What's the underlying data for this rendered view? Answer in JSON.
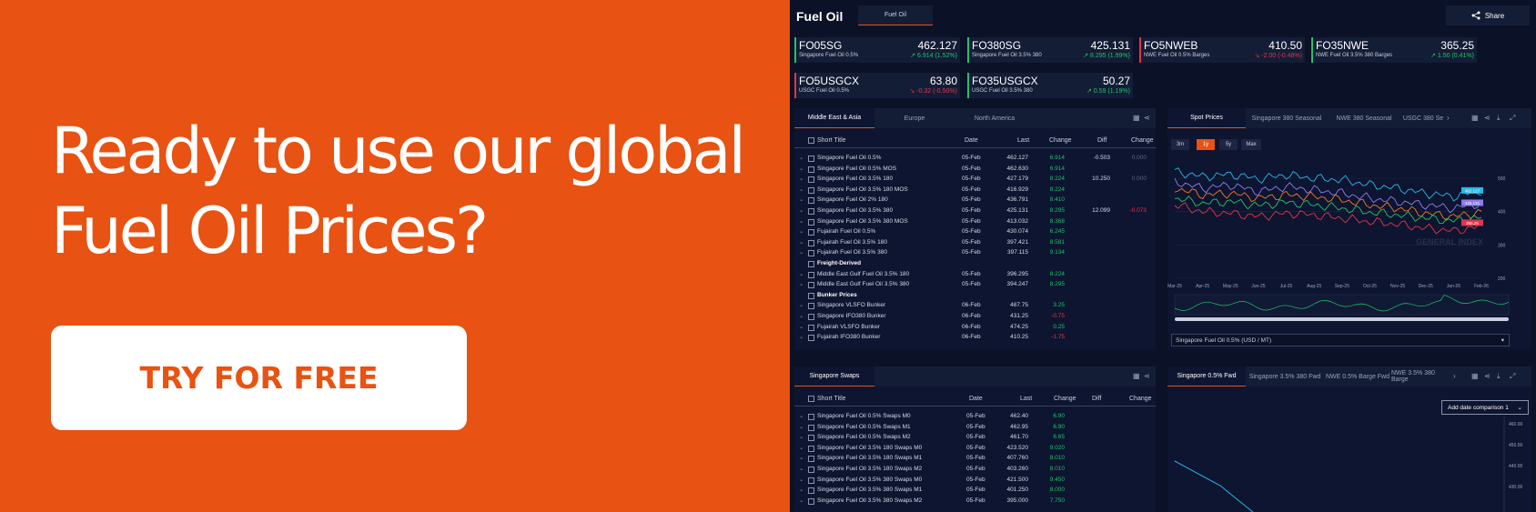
{
  "promo": {
    "heading_line1": "Ready to use our global",
    "heading_line2": "Fuel Oil Prices?",
    "cta_label": "TRY FOR FREE"
  },
  "dashboard": {
    "title": "Fuel Oil",
    "top_tab": "Fuel Oil",
    "share_label": "Share"
  },
  "tickers": [
    {
      "code": "FO05SG",
      "price": "462.127",
      "name": "Singapore Fuel Oil 0.5%",
      "change": "6.914 (1.52%)",
      "direction": "up"
    },
    {
      "code": "FO380SG",
      "price": "425.131",
      "name": "Singapore Fuel Oil 3.5% 380",
      "change": "8.295 (1.99%)",
      "direction": "up"
    },
    {
      "code": "FO5NWEB",
      "price": "410.50",
      "name": "NWE Fuel Oil 0.5% Barges",
      "change": "-2.00 (-0.48%)",
      "direction": "down"
    },
    {
      "code": "FO35NWE",
      "price": "365.25",
      "name": "NWE Fuel Oil 3.5% 380 Barges",
      "change": "1.50 (0.41%)",
      "direction": "up"
    },
    {
      "code": "FO5USGCX",
      "price": "63.80",
      "name": "USGC Fuel Oil 0.5%",
      "change": "-0.32 (-0.50%)",
      "direction": "down"
    },
    {
      "code": "FO35USGCX",
      "price": "50.27",
      "name": "USGC Fuel Oil 3.5% 380",
      "change": "0.59 (1.19%)",
      "direction": "up"
    }
  ],
  "prices_panel": {
    "tabs": [
      "Middle East & Asia",
      "Europe",
      "North America"
    ],
    "headers": {
      "title": "Short Title",
      "date": "Date",
      "last": "Last",
      "change": "Change",
      "diff": "Diff",
      "diff_change": "Change"
    },
    "rows": [
      {
        "title": "Singapore Fuel Oil 0.5%",
        "date": "05-Feb",
        "last": "462.127",
        "change": "6.914",
        "diff": "-0.503",
        "diff_change": "0.000",
        "dir": "up"
      },
      {
        "title": "Singapore Fuel Oil 0.5% MOS",
        "date": "05-Feb",
        "last": "462.630",
        "change": "6.914",
        "diff": "",
        "diff_change": "",
        "dir": "up"
      },
      {
        "title": "Singapore Fuel Oil 3.5% 180",
        "date": "05-Feb",
        "last": "427.179",
        "change": "8.224",
        "diff": "10.250",
        "diff_change": "0.000",
        "dir": "up"
      },
      {
        "title": "Singapore Fuel Oil 3.5% 180 MOS",
        "date": "05-Feb",
        "last": "416.929",
        "change": "8.224",
        "diff": "",
        "diff_change": "",
        "dir": "up"
      },
      {
        "title": "Singapore Fuel Oil 2% 180",
        "date": "05-Feb",
        "last": "436.791",
        "change": "8.410",
        "diff": "",
        "diff_change": "",
        "dir": "up"
      },
      {
        "title": "Singapore Fuel Oil 3.5% 380",
        "date": "05-Feb",
        "last": "425.131",
        "change": "8.295",
        "diff": "12.099",
        "diff_change": "-0.073",
        "dir": "up"
      },
      {
        "title": "Singapore Fuel Oil 3.5% 380 MOS",
        "date": "05-Feb",
        "last": "413.032",
        "change": "8.368",
        "diff": "",
        "diff_change": "",
        "dir": "up"
      },
      {
        "title": "Fujairah Fuel Oil 0.5%",
        "date": "05-Feb",
        "last": "430.074",
        "change": "6.245",
        "diff": "",
        "diff_change": "",
        "dir": "up"
      },
      {
        "title": "Fujairah Fuel Oil 3.5% 180",
        "date": "05-Feb",
        "last": "397.421",
        "change": "8.581",
        "diff": "",
        "diff_change": "",
        "dir": "up"
      },
      {
        "title": "Fujairah Fuel Oil 3.5% 380",
        "date": "05-Feb",
        "last": "397.115",
        "change": "9.134",
        "diff": "",
        "diff_change": "",
        "dir": "up"
      },
      {
        "group": "Freight-Derived"
      },
      {
        "title": "Middle East Gulf Fuel Oil 3.5% 180",
        "date": "05-Feb",
        "last": "396.295",
        "change": "8.224",
        "diff": "",
        "diff_change": "",
        "dir": "up"
      },
      {
        "title": "Middle East Gulf Fuel Oil 3.5% 380",
        "date": "05-Feb",
        "last": "394.247",
        "change": "8.295",
        "diff": "",
        "diff_change": "",
        "dir": "up"
      },
      {
        "group": "Bunker Prices"
      },
      {
        "title": "Singapore VLSFO Bunker",
        "date": "06-Feb",
        "last": "487.75",
        "change": "3.25",
        "diff": "",
        "diff_change": "",
        "dir": "up"
      },
      {
        "title": "Singapore IFO380 Bunker",
        "date": "06-Feb",
        "last": "431.25",
        "change": "-0.75",
        "diff": "",
        "diff_change": "",
        "dir": "down"
      },
      {
        "title": "Fujairah VLSFO Bunker",
        "date": "06-Feb",
        "last": "474.25",
        "change": "0.25",
        "diff": "",
        "diff_change": "",
        "dir": "up"
      },
      {
        "title": "Fujairah IFO380 Bunker",
        "date": "06-Feb",
        "last": "410.25",
        "change": "-1.75",
        "diff": "",
        "diff_change": "",
        "dir": "down"
      }
    ]
  },
  "spot_panel": {
    "tabs": [
      "Spot Prices",
      "Singapore 380 Seasonal",
      "NWE 380 Seasonal",
      "USGC 380 Se"
    ],
    "ranges": [
      "3m",
      "1y",
      "5y",
      "Max"
    ],
    "active_range": "1y",
    "select_value": "Singapore Fuel Oil 0.5% (USD / MT)",
    "watermark": "GENERAL INDEX",
    "chart_data": {
      "type": "line",
      "x": [
        "Mar-25",
        "Apr-25",
        "May-25",
        "Jun-25",
        "Jul-25",
        "Aug-25",
        "Sep-25",
        "Oct-25",
        "Nov-25",
        "Dec-25",
        "Jan-26",
        "Feb-26"
      ],
      "yticks": [
        "500",
        "400",
        "300",
        "200"
      ],
      "ylim": [
        200,
        560
      ],
      "series": [
        {
          "color": "#2ab7e8",
          "values": [
            520,
            505,
            512,
            498,
            510,
            500,
            495,
            480,
            470,
            455,
            445,
            462
          ]
        },
        {
          "color": "#8d7cf0",
          "values": [
            490,
            470,
            480,
            460,
            475,
            465,
            455,
            440,
            430,
            420,
            410,
            425
          ]
        },
        {
          "color": "#f07a2a",
          "values": [
            470,
            450,
            455,
            440,
            450,
            445,
            435,
            420,
            410,
            395,
            385,
            398
          ]
        },
        {
          "color": "#1fc36b",
          "values": [
            440,
            425,
            430,
            418,
            428,
            420,
            410,
            398,
            390,
            380,
            372,
            382
          ]
        },
        {
          "color": "#e0364b",
          "values": [
            420,
            400,
            395,
            385,
            395,
            390,
            380,
            370,
            362,
            350,
            342,
            356
          ]
        }
      ],
      "tag_values": [
        "462.127",
        "425.131",
        "365.25"
      ]
    }
  },
  "swaps_panel": {
    "tabs": [
      "Singapore Swaps"
    ],
    "headers": {
      "title": "Short Title",
      "date": "Date",
      "last": "Last",
      "change": "Change",
      "diff": "Diff",
      "diff_change": "Change"
    },
    "rows": [
      {
        "title": "Singapore Fuel Oil 0.5% Swaps M0",
        "date": "05-Feb",
        "last": "462.40",
        "change": "6.90"
      },
      {
        "title": "Singapore Fuel Oil 0.5% Swaps M1",
        "date": "05-Feb",
        "last": "462.95",
        "change": "6.90"
      },
      {
        "title": "Singapore Fuel Oil 0.5% Swaps M2",
        "date": "05-Feb",
        "last": "461.70",
        "change": "6.65"
      },
      {
        "title": "Singapore Fuel Oil 3.5% 180 Swaps M0",
        "date": "05-Feb",
        "last": "423.520",
        "change": "9.020"
      },
      {
        "title": "Singapore Fuel Oil 3.5% 180 Swaps M1",
        "date": "05-Feb",
        "last": "407.760",
        "change": "8.010"
      },
      {
        "title": "Singapore Fuel Oil 3.5% 180 Swaps M2",
        "date": "05-Feb",
        "last": "403.260",
        "change": "8.010"
      },
      {
        "title": "Singapore Fuel Oil 3.5% 380 Swaps M0",
        "date": "05-Feb",
        "last": "421.500",
        "change": "9.450"
      },
      {
        "title": "Singapore Fuel Oil 3.5% 380 Swaps M1",
        "date": "05-Feb",
        "last": "401.250",
        "change": "8.000"
      },
      {
        "title": "Singapore Fuel Oil 3.5% 380 Swaps M2",
        "date": "05-Feb",
        "last": "395.000",
        "change": "7.750"
      }
    ]
  },
  "fwd_panel": {
    "tabs": [
      "Singapore 0.5% Fwd",
      "Singapore 3.5% 380 Fwd",
      "NWE 0.5% Barge Fwd",
      "NWE 3.5% 380 Barge"
    ],
    "compare_label": "Add date comparison 1",
    "yticks": [
      "460.00",
      "450.00",
      "440.00",
      "430.00"
    ]
  },
  "colors": {
    "accent": "#e85212",
    "up": "#1fc36b",
    "down": "#e0364b"
  }
}
